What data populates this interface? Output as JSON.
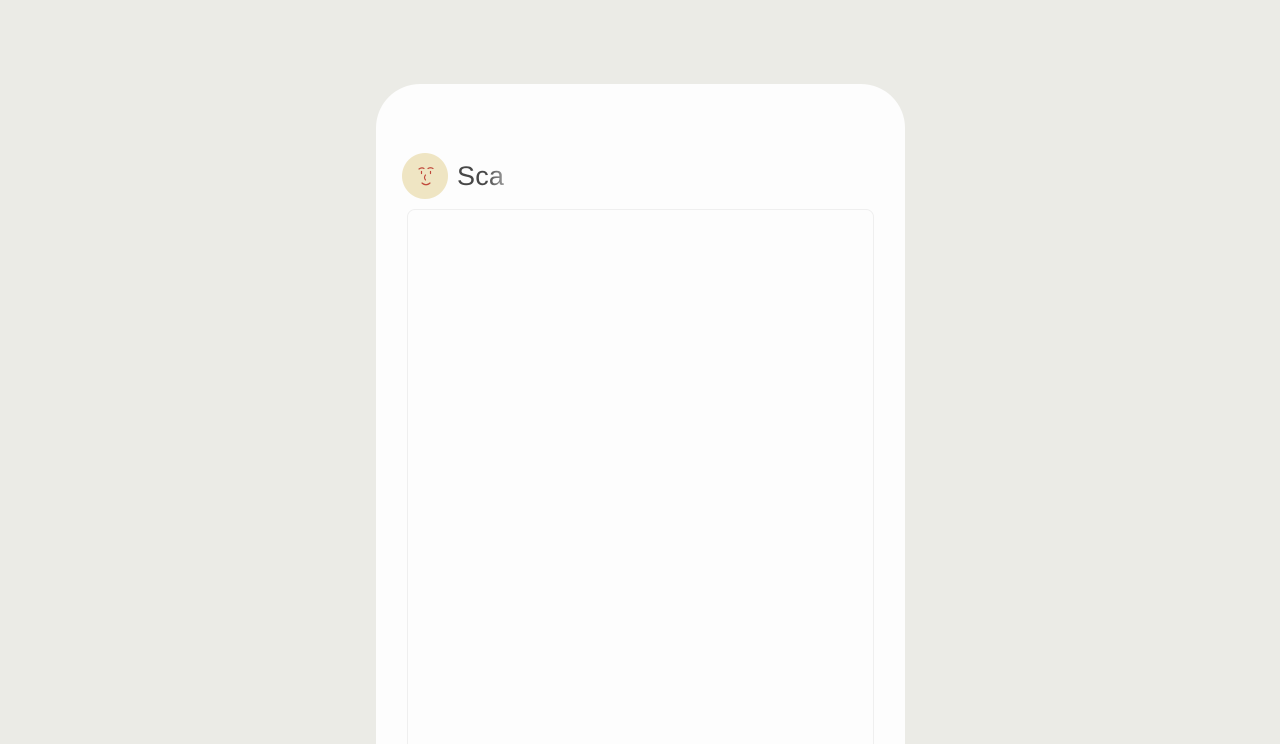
{
  "app": {
    "title": "Sca"
  },
  "header": {
    "avatar_icon": "face-icon",
    "avatar_color": "#efe5c3",
    "face_line_color": "#c0483a"
  },
  "colors": {
    "background": "#ebebe6",
    "phone": "#fdfdfd",
    "panel_border": "#efefef",
    "title": "#474747"
  }
}
